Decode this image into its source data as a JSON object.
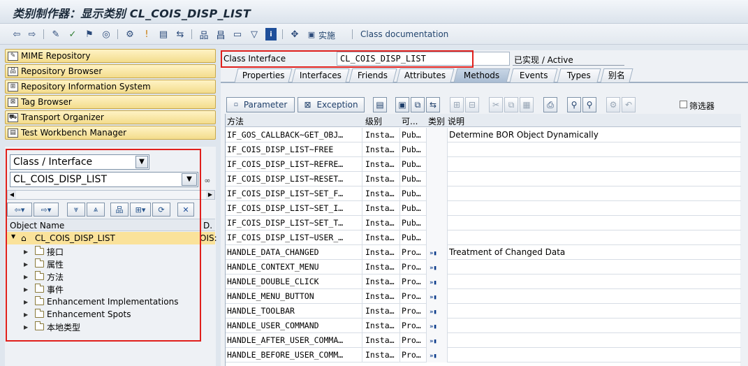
{
  "window": {
    "title": "类别制作器：显示类别 CL_COIS_DISP_LIST"
  },
  "toolbar": {
    "implement_label": "实施",
    "class_doc_label": "Class documentation",
    "icons": [
      "back-icon",
      "forward-icon",
      "edit-icon",
      "check-icon",
      "activate-icon",
      "where-used-icon",
      "test-icon",
      "hierarchy-icon",
      "attention-icon",
      "object-list-icon",
      "navigate-icon",
      "display-object-icon",
      "enhance-icon",
      "list-icon",
      "filter-icon",
      "info-icon",
      "other-object-icon"
    ]
  },
  "nav": {
    "items": [
      {
        "label": "MIME Repository"
      },
      {
        "label": "Repository Browser"
      },
      {
        "label": "Repository Information System"
      },
      {
        "label": "Tag Browser"
      },
      {
        "label": "Transport Organizer"
      },
      {
        "label": "Test Workbench Manager"
      }
    ]
  },
  "browser": {
    "object_type": "Class / Interface",
    "object_name": "CL_COIS_DISP_LIST",
    "columns": {
      "name": "Object Name",
      "desc": "D."
    },
    "root": {
      "label": "CL_COIS_DISP_LIST",
      "desc": "OIS:"
    },
    "children": [
      {
        "label": "接口"
      },
      {
        "label": "属性"
      },
      {
        "label": "方法"
      },
      {
        "label": "事件"
      },
      {
        "label": "Enhancement Implementations"
      },
      {
        "label": "Enhancement Spots"
      },
      {
        "label": "本地类型"
      }
    ]
  },
  "header": {
    "class_interface_label": "Class Interface",
    "class_name": "CL_COIS_DISP_LIST",
    "status": "已实现 / Active"
  },
  "tabs": [
    {
      "label": "Properties"
    },
    {
      "label": "Interfaces"
    },
    {
      "label": "Friends"
    },
    {
      "label": "Attributes"
    },
    {
      "label": "Methods",
      "active": true
    },
    {
      "label": "Events"
    },
    {
      "label": "Types"
    },
    {
      "label": "别名"
    }
  ],
  "methods_toolbar": {
    "parameter_label": "Parameter",
    "exception_label": "Exception",
    "filter_label": "筛选器"
  },
  "methods": {
    "columns": [
      "方法",
      "级别",
      "可...",
      "类别",
      "说明"
    ],
    "rows": [
      {
        "method": "IF_GOS_CALLBACK~GET_OBJ…",
        "level": "Insta…",
        "vis": "Pub…",
        "event": false,
        "desc": "Determine BOR Object Dynamically"
      },
      {
        "method": "IF_COIS_DISP_LIST~FREE",
        "level": "Insta…",
        "vis": "Pub…",
        "event": false,
        "desc": ""
      },
      {
        "method": "IF_COIS_DISP_LIST~REFRE…",
        "level": "Insta…",
        "vis": "Pub…",
        "event": false,
        "desc": ""
      },
      {
        "method": "IF_COIS_DISP_LIST~RESET…",
        "level": "Insta…",
        "vis": "Pub…",
        "event": false,
        "desc": ""
      },
      {
        "method": "IF_COIS_DISP_LIST~SET_F…",
        "level": "Insta…",
        "vis": "Pub…",
        "event": false,
        "desc": ""
      },
      {
        "method": "IF_COIS_DISP_LIST~SET_I…",
        "level": "Insta…",
        "vis": "Pub…",
        "event": false,
        "desc": ""
      },
      {
        "method": "IF_COIS_DISP_LIST~SET_T…",
        "level": "Insta…",
        "vis": "Pub…",
        "event": false,
        "desc": ""
      },
      {
        "method": "IF_COIS_DISP_LIST~USER_…",
        "level": "Insta…",
        "vis": "Pub…",
        "event": false,
        "desc": ""
      },
      {
        "method": "HANDLE_DATA_CHANGED",
        "level": "Insta…",
        "vis": "Pro…",
        "event": true,
        "desc": "Treatment of Changed Data"
      },
      {
        "method": "HANDLE_CONTEXT_MENU",
        "level": "Insta…",
        "vis": "Pro…",
        "event": true,
        "desc": ""
      },
      {
        "method": "HANDLE_DOUBLE_CLICK",
        "level": "Insta…",
        "vis": "Pro…",
        "event": true,
        "desc": ""
      },
      {
        "method": "HANDLE_MENU_BUTTON",
        "level": "Insta…",
        "vis": "Pro…",
        "event": true,
        "desc": ""
      },
      {
        "method": "HANDLE_TOOLBAR",
        "level": "Insta…",
        "vis": "Pro…",
        "event": true,
        "desc": ""
      },
      {
        "method": "HANDLE_USER_COMMAND",
        "level": "Insta…",
        "vis": "Pro…",
        "event": true,
        "desc": ""
      },
      {
        "method": "HANDLE_AFTER_USER_COMMA…",
        "level": "Insta…",
        "vis": "Pro…",
        "event": true,
        "desc": ""
      },
      {
        "method": "HANDLE_BEFORE_USER_COMM…",
        "level": "Insta…",
        "vis": "Pro…",
        "event": true,
        "desc": ""
      }
    ]
  },
  "colors": {
    "highlight_border": "#e0201c",
    "nav_button": "#f3dc8c",
    "selected_row": "#fae29a"
  }
}
